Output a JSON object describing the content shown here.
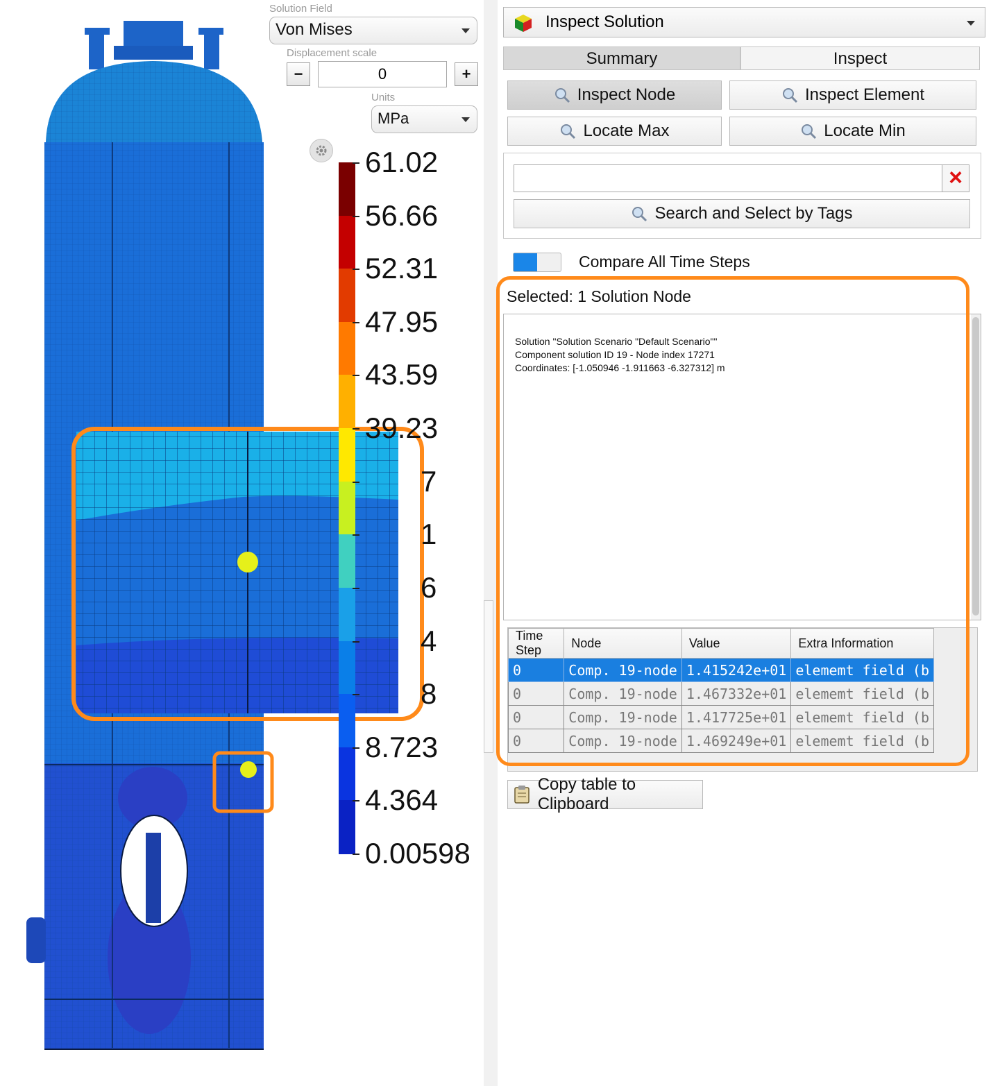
{
  "viewport": {
    "solution_field_label": "Solution Field",
    "solution_field_value": "Von Mises",
    "displacement_label": "Displacement scale",
    "displacement_value": "0",
    "minus_label": "−",
    "plus_label": "+",
    "units_label": "Units",
    "units_value": "MPa",
    "legend": {
      "values": [
        "61.02",
        "56.66",
        "52.31",
        "47.95",
        "43.59",
        "39.23",
        "7",
        "1",
        "6",
        "4",
        "8",
        "8.723",
        "4.364",
        "0.00598"
      ],
      "colors": [
        "#7a0000",
        "#c40000",
        "#e23b00",
        "#ff7a00",
        "#ffb000",
        "#ffe800",
        "#c8f020",
        "#40d0c0",
        "#1aa0e8",
        "#0a7fe8",
        "#0a5ef0",
        "#0a34e0",
        "#0a22c4",
        "#0a1aa8"
      ]
    },
    "vessel_colors": {
      "shell": "#1a6ed8",
      "head": "#1b84d6",
      "lower": "#2150d0",
      "callout_border": "#ff8a1a",
      "marker": "#e6f01a"
    }
  },
  "panel": {
    "mode_select": "Inspect Solution",
    "tabs": {
      "summary": "Summary",
      "inspect": "Inspect"
    },
    "buttons": {
      "inspect_node": "Inspect Node",
      "inspect_element": "Inspect Element",
      "locate_max": "Locate Max",
      "locate_min": "Locate Min",
      "search_tags": "Search and Select by Tags",
      "copy_clipboard": "Copy table to Clipboard"
    },
    "search_value": "",
    "clear_icon": "×",
    "compare_label": "Compare All Time Steps",
    "selected_text": "Selected: 1 Solution Node",
    "info_lines": [
      "Solution \"Solution Scenario \"Default Scenario\"\"",
      "Component solution ID 19 - Node index 17271",
      "Coordinates: [-1.050946 -1.911663 -6.327312] m"
    ],
    "table": {
      "headers": [
        "Time Step",
        "Node",
        "Value",
        "Extra Information"
      ],
      "rows": [
        [
          "0",
          "Comp. 19-node",
          "1.415242e+01",
          "elememt field (b"
        ],
        [
          "0",
          "Comp. 19-node",
          "1.467332e+01",
          "elememt field (b"
        ],
        [
          "0",
          "Comp. 19-node",
          "1.417725e+01",
          "elememt field (b"
        ],
        [
          "0",
          "Comp. 19-node",
          "1.469249e+01",
          "elememt field (b"
        ]
      ]
    }
  }
}
